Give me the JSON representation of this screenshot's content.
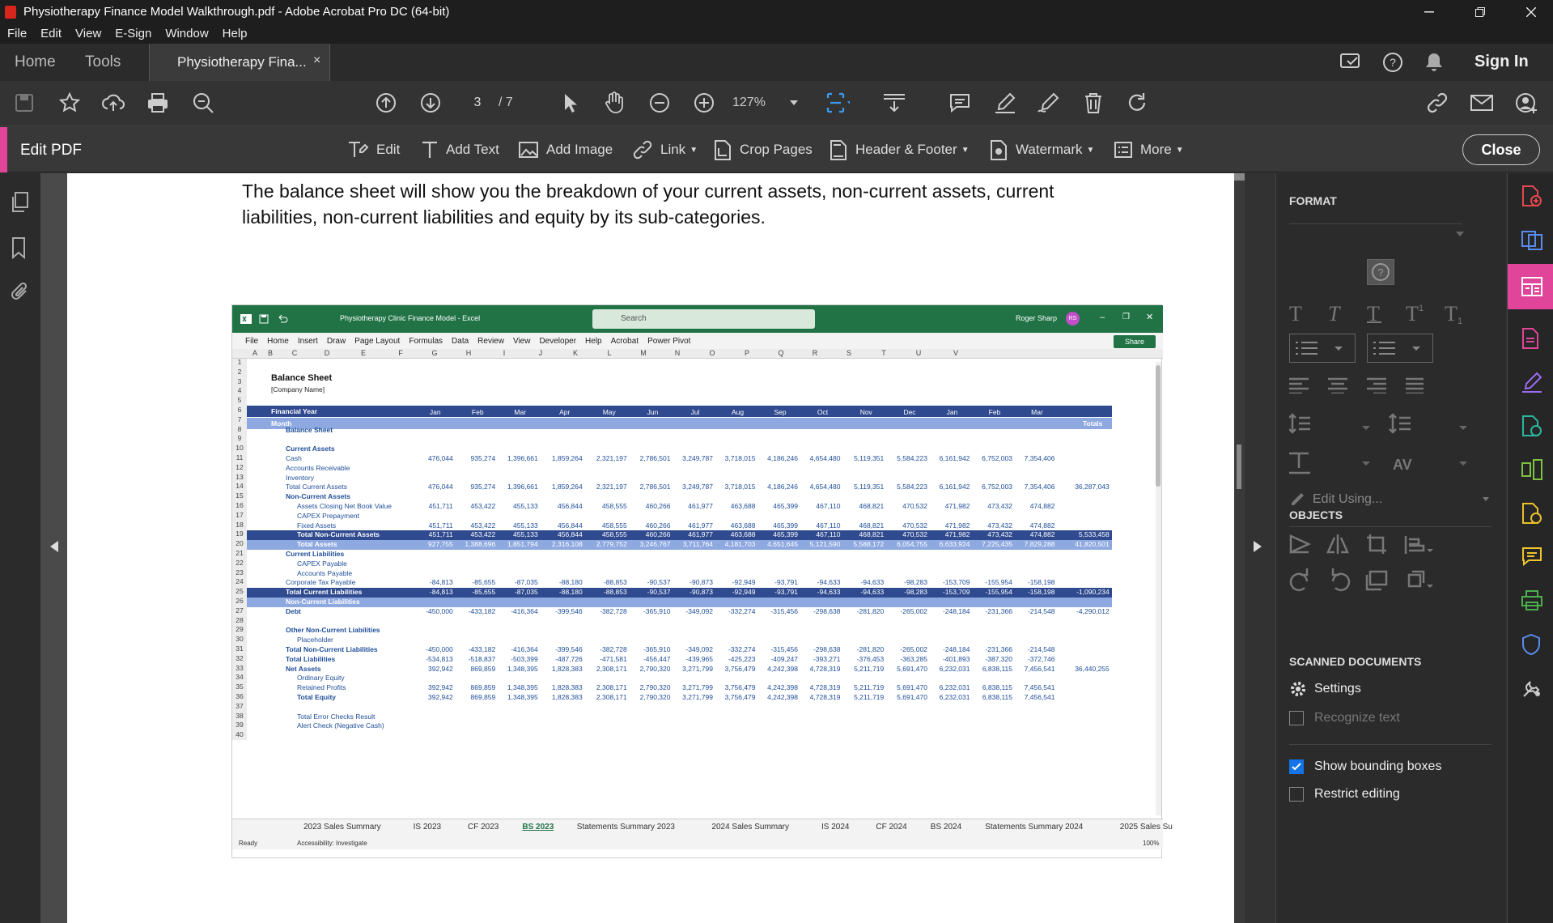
{
  "window": {
    "title": "Physiotherapy Finance Model Walkthrough.pdf - Adobe Acrobat Pro DC (64-bit)"
  },
  "menu": [
    "File",
    "Edit",
    "View",
    "E-Sign",
    "Window",
    "Help"
  ],
  "tabs": {
    "home": "Home",
    "tools": "Tools",
    "document": "Physiotherapy Fina...",
    "sign_in": "Sign In"
  },
  "toolbar": {
    "page_current": "3",
    "page_total": "/ 7",
    "zoom": "127%"
  },
  "edit_bar": {
    "label": "Edit PDF",
    "edit": "Edit",
    "add_text": "Add Text",
    "add_image": "Add Image",
    "link": "Link",
    "crop": "Crop Pages",
    "header_footer": "Header & Footer",
    "watermark": "Watermark",
    "more": "More",
    "close": "Close"
  },
  "document": {
    "text": "The balance sheet will show you the breakdown of your current assets, non-current assets, current liabilities, non-current liabilities and equity by its sub-categories."
  },
  "excel": {
    "title": "Physiotherapy Clinic Finance Model  -  Excel",
    "search": "Search",
    "user": "Roger Sharp",
    "user_initials": "RS",
    "share": "Share",
    "menu": [
      "File",
      "Home",
      "Insert",
      "Draw",
      "Page Layout",
      "Formulas",
      "Data",
      "Review",
      "View",
      "Developer",
      "Help",
      "Acrobat",
      "Power Pivot"
    ],
    "columns": [
      "A",
      "B",
      "C",
      "D",
      "E",
      "F",
      "G",
      "H",
      "I",
      "J",
      "K",
      "L",
      "M",
      "N",
      "O",
      "P",
      "Q",
      "R",
      "S",
      "T",
      "U",
      "V"
    ],
    "heading": "Balance Sheet",
    "company": "[Company Name]",
    "fy_label": "Financial Year",
    "month_label": "Month",
    "years": [
      "2023",
      "2023",
      "2023",
      "2023",
      "2023",
      "2023",
      "2023",
      "2023",
      "2023",
      "2023",
      "2023",
      "2023",
      "2024",
      "2024",
      "2024"
    ],
    "months": [
      "Jan",
      "Feb",
      "Mar",
      "Apr",
      "May",
      "Jun",
      "Jul",
      "Aug",
      "Sep",
      "Oct",
      "Nov",
      "Dec",
      "Jan",
      "Feb",
      "Mar"
    ],
    "totals_label": "Totals",
    "rows": [
      {
        "r": "8",
        "label": "Balance Sheet",
        "indent": 1,
        "bold": true
      },
      {
        "r": "10",
        "label": "Current Assets",
        "indent": 1,
        "bold": true
      },
      {
        "r": "11",
        "label": "Cash",
        "indent": 1,
        "vals": [
          "476,044",
          "935,274",
          "1,396,661",
          "1,859,264",
          "2,321,197",
          "2,786,501",
          "3,249,787",
          "3,718,015",
          "4,186,246",
          "4,654,480",
          "5,119,351",
          "5,584,223",
          "6,161,942",
          "6,752,003",
          "7,354,406"
        ]
      },
      {
        "r": "12",
        "label": "Accounts Receivable",
        "indent": 1
      },
      {
        "r": "13",
        "label": "Inventory",
        "indent": 1
      },
      {
        "r": "14",
        "label": "Total Current Assets",
        "indent": 1,
        "vals": [
          "476,044",
          "935,274",
          "1,396,661",
          "1,859,264",
          "2,321,197",
          "2,786,501",
          "3,249,787",
          "3,718,015",
          "4,186,246",
          "4,654,480",
          "5,119,351",
          "5,584,223",
          "6,161,942",
          "6,752,003",
          "7,354,406"
        ],
        "total": "36,287,043"
      },
      {
        "r": "15",
        "label": "Non-Current Assets",
        "indent": 1,
        "bold": true
      },
      {
        "r": "16",
        "label": "Assets Closing Net Book Value",
        "indent": 2,
        "vals": [
          "451,711",
          "453,422",
          "455,133",
          "456,844",
          "458,555",
          "460,266",
          "461,977",
          "463,688",
          "465,399",
          "467,110",
          "468,821",
          "470,532",
          "471,982",
          "473,432",
          "474,882"
        ]
      },
      {
        "r": "17",
        "label": "CAPEX Prepayment",
        "indent": 2
      },
      {
        "r": "18",
        "label": "Fixed Assets",
        "indent": 2,
        "vals": [
          "451,711",
          "453,422",
          "455,133",
          "456,844",
          "458,555",
          "460,266",
          "461,977",
          "463,688",
          "465,399",
          "467,110",
          "468,821",
          "470,532",
          "471,982",
          "473,432",
          "474,882"
        ]
      },
      {
        "r": "19",
        "label": "Total Non-Current Assets",
        "indent": 2,
        "band": "dark",
        "vals": [
          "451,711",
          "453,422",
          "455,133",
          "456,844",
          "458,555",
          "460,266",
          "461,977",
          "463,688",
          "465,399",
          "467,110",
          "468,821",
          "470,532",
          "471,982",
          "473,432",
          "474,882"
        ],
        "total": "5,533,458"
      },
      {
        "r": "20",
        "label": "Total Assets",
        "indent": 2,
        "band": "light",
        "vals": [
          "927,755",
          "1,388,696",
          "1,851,794",
          "2,316,108",
          "2,779,752",
          "3,246,767",
          "3,711,764",
          "4,181,703",
          "4,651,645",
          "5,121,590",
          "5,588,172",
          "6,054,755",
          "6,633,924",
          "7,225,435",
          "7,829,288"
        ],
        "total": "41,820,501"
      },
      {
        "r": "21",
        "label": "Current Liabilities",
        "indent": 1,
        "bold": true
      },
      {
        "r": "22",
        "label": "CAPEX Payable",
        "indent": 2
      },
      {
        "r": "23",
        "label": "Accounts Payable",
        "indent": 2
      },
      {
        "r": "24",
        "label": "Corporate Tax Payable",
        "indent": 1,
        "vals": [
          "-84,813",
          "-85,655",
          "-87,035",
          "-88,180",
          "-88,853",
          "-90,537",
          "-90,873",
          "-92,949",
          "-93,791",
          "-94,633",
          "-94,633",
          "-98,283",
          "-153,709",
          "-155,954",
          "-158,198"
        ]
      },
      {
        "r": "25",
        "label": "Total Current Liabilities",
        "indent": 1,
        "band": "dark",
        "vals": [
          "-84,813",
          "-85,655",
          "-87,035",
          "-88,180",
          "-88,853",
          "-90,537",
          "-90,873",
          "-92,949",
          "-93,791",
          "-94,633",
          "-94,633",
          "-98,283",
          "-153,709",
          "-155,954",
          "-158,198"
        ],
        "total": "-1,090,234"
      },
      {
        "r": "26",
        "label": "Non-Current Liabilities",
        "indent": 1,
        "band": "light"
      },
      {
        "r": "27",
        "label": "Debt",
        "indent": 1,
        "bold": true,
        "vals": [
          "-450,000",
          "-433,182",
          "-416,364",
          "-399,546",
          "-382,728",
          "-365,910",
          "-349,092",
          "-332,274",
          "-315,456",
          "-298,638",
          "-281,820",
          "-265,002",
          "-248,184",
          "-231,366",
          "-214,548"
        ],
        "total": "-4,290,012"
      },
      {
        "r": "29",
        "label": "Other Non-Current Liabilities",
        "indent": 1,
        "bold": true
      },
      {
        "r": "30",
        "label": "Placeholder",
        "indent": 2
      },
      {
        "r": "31",
        "label": "Total Non-Current Liabilities",
        "indent": 1,
        "bold": true,
        "vals": [
          "-450,000",
          "-433,182",
          "-416,364",
          "-399,546",
          "-382,728",
          "-365,910",
          "-349,092",
          "-332,274",
          "-315,456",
          "-298,638",
          "-281,820",
          "-265,002",
          "-248,184",
          "-231,366",
          "-214,548"
        ]
      },
      {
        "r": "32",
        "label": "Total Liabilities",
        "indent": 1,
        "bold": true,
        "vals": [
          "-534,813",
          "-518,837",
          "-503,399",
          "-487,726",
          "-471,581",
          "-456,447",
          "-439,965",
          "-425,223",
          "-409,247",
          "-393,271",
          "-376,453",
          "-363,285",
          "-401,893",
          "-387,320",
          "-372,746"
        ]
      },
      {
        "r": "33",
        "label": "Net Assets",
        "indent": 1,
        "bold": true,
        "vals": [
          "392,942",
          "869,859",
          "1,348,395",
          "1,828,383",
          "2,308,171",
          "2,790,320",
          "3,271,799",
          "3,756,479",
          "4,242,398",
          "4,728,319",
          "5,211,719",
          "5,691,470",
          "6,232,031",
          "6,838,115",
          "7,456,541"
        ],
        "total": "36,440,255"
      },
      {
        "r": "34",
        "label": "Ordinary Equity",
        "indent": 2
      },
      {
        "r": "35",
        "label": "Retained Profits",
        "indent": 2,
        "vals": [
          "392,942",
          "869,859",
          "1,348,395",
          "1,828,383",
          "2,308,171",
          "2,790,320",
          "3,271,799",
          "3,756,479",
          "4,242,398",
          "4,728,319",
          "5,211,719",
          "5,691,470",
          "6,232,031",
          "6,838,115",
          "7,456,541"
        ]
      },
      {
        "r": "36",
        "label": "Total Equity",
        "indent": 2,
        "bold": true,
        "vals": [
          "392,942",
          "869,859",
          "1,348,395",
          "1,828,383",
          "2,308,171",
          "2,790,320",
          "3,271,799",
          "3,756,479",
          "4,242,398",
          "4,728,319",
          "5,211,719",
          "5,691,470",
          "6,232,031",
          "6,838,115",
          "7,456,541"
        ]
      },
      {
        "r": "38",
        "label": "Total Error Checks Result",
        "indent": 2
      },
      {
        "r": "39",
        "label": "Alert Check (Negative Cash)",
        "indent": 2
      }
    ],
    "sheet_tabs": [
      "2023 Sales Summary",
      "IS 2023",
      "CF 2023",
      "BS 2023",
      "Statements Summary 2023",
      "2024 Sales Summary",
      "IS 2024",
      "CF 2024",
      "BS 2024",
      "Statements Summary 2024",
      "2025 Sales Su"
    ],
    "active_sheet": "BS 2023",
    "status_ready": "Ready",
    "status_accessibility": "Accessibility: Investigate",
    "status_zoom": "100%"
  },
  "right_panel": {
    "format": "FORMAT",
    "objects": "OBJECTS",
    "edit_using": "Edit Using...",
    "scanned": "SCANNED DOCUMENTS",
    "settings": "Settings",
    "recognize": "Recognize text",
    "show_bbox": "Show bounding boxes",
    "restrict": "Restrict editing",
    "show_bbox_checked": true,
    "restrict_checked": false
  },
  "colors": {
    "accent": "#e1459a",
    "excel_green": "#217346",
    "band_dark": "#2f4a8f",
    "band_light": "#8ea8e0",
    "checkbox": "#1473e6"
  }
}
